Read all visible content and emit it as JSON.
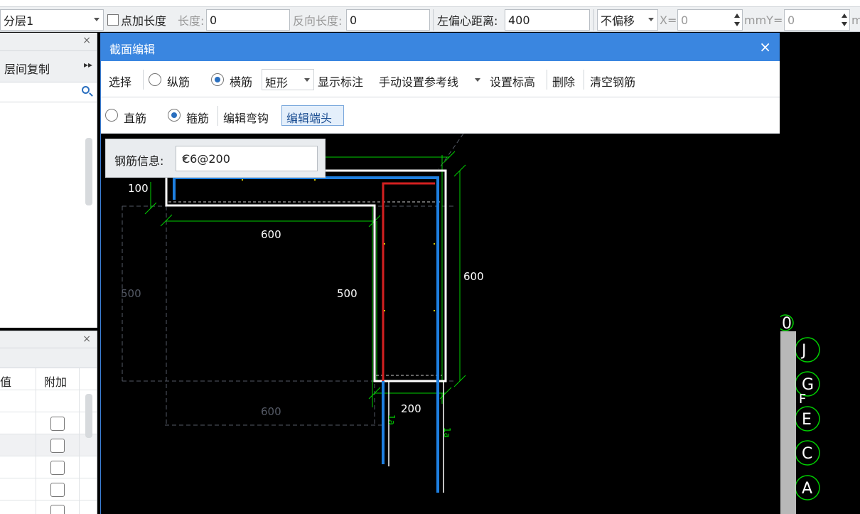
{
  "toolbar": {
    "layer": "分层1",
    "add_length_label": "点加长度",
    "length_label": "长度:",
    "length_value": "0",
    "reverse_length_label": "反向长度:",
    "reverse_length_value": "0",
    "left_offset_label": "左偏心距离:",
    "left_offset_value": "400",
    "offset_mode": "不偏移",
    "x_label": "X=",
    "x_value": "0",
    "mmy_label": "mmY=",
    "y_value": "0",
    "m_label": "m"
  },
  "left_panel_1": {
    "close": "×",
    "floor_copy": "层间复制",
    "more": "▸▸"
  },
  "left_panel_2": {
    "close": "×",
    "col1_header": "值",
    "col2_header": "附加",
    "rows": 6
  },
  "dialog": {
    "title": "截面编辑",
    "close": "×",
    "row1": {
      "select": "选择",
      "longitudinal": "纵筋",
      "transverse": "横筋",
      "shape": "矩形",
      "show_annotations": "显示标注",
      "manual_ref_line": "手动设置参考线",
      "set_elevation": "设置标高",
      "delete": "删除",
      "clear_rebar": "清空钢筋"
    },
    "row2": {
      "straight": "直筋",
      "stirrup": "箍筋",
      "edit_hook": "编辑弯钩",
      "edit_end": "编辑端头"
    },
    "rebar_info_label": "钢筋信息:",
    "rebar_info_value": "C6@200"
  },
  "drawing": {
    "dims": {
      "d100": "100",
      "d600_top": "600",
      "d500_left_dim": "500",
      "d500_inner": "500",
      "d600_right": "600",
      "d200": "200",
      "d600_bottom": "600",
      "la1": "1a",
      "la2": "1a"
    }
  },
  "axis_labels": [
    "0",
    "J",
    "G",
    "F",
    "E",
    "C",
    "A"
  ],
  "colors": {
    "title_blue": "#3a86e0",
    "dim_green": "#00d000",
    "rebar_blue": "#1e7fe0",
    "rebar_red": "#d32020",
    "outline_white": "#ffffff"
  }
}
